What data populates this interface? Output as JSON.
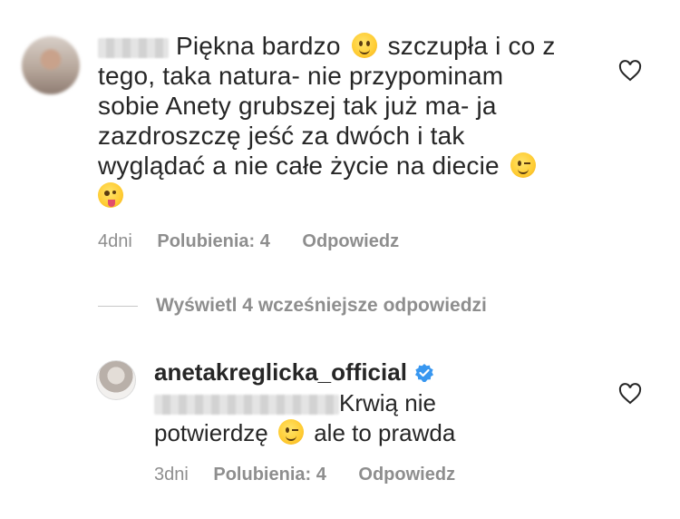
{
  "comment1": {
    "text_line1": "Piękna bardzo",
    "text_line1b": "szczupła i co z",
    "text_rest": "tego, taka natura- nie przypominam sobie Anety grubszej tak już ma- ja zazdroszczę jeść za dwóch i tak wyglądać a nie całe życie na diecie",
    "time": "4dni",
    "likes": "Polubienia: 4",
    "reply": "Odpowiedz"
  },
  "replies_link": "Wyświetl 4 wcześniejsze odpowiedzi",
  "comment2": {
    "username": "anetakreglicka_official",
    "text_a": "Krwią nie",
    "text_b": "potwierdzę",
    "text_c": "ale to prawda",
    "time": "3dni",
    "likes": "Polubienia: 4",
    "reply": "Odpowiedz"
  },
  "icons": [
    "smile-emoji",
    "wink-emoji",
    "zany-face-emoji",
    "heart-icon",
    "verified-badge-icon"
  ],
  "colors": {
    "text": "#262626",
    "muted": "#8e8e8e",
    "verified": "#3897f0"
  }
}
